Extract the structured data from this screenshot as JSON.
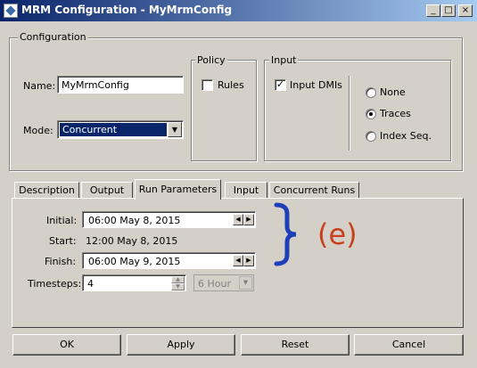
{
  "window": {
    "title": "MRM Configuration - MyMrmConfig",
    "controls": {
      "minimize": "_",
      "maximize": "□",
      "close": "×"
    }
  },
  "configuration": {
    "legend": "Configuration",
    "name_label": "Name:",
    "name_value": "MyMrmConfig",
    "mode_label": "Mode:",
    "mode_value": "Concurrent"
  },
  "policy": {
    "legend": "Policy",
    "rules_label": "Rules",
    "rules_checked": false
  },
  "input": {
    "legend": "Input",
    "input_dmis_label": "Input DMIs",
    "input_dmis_checked": true,
    "radios": [
      {
        "label": "None",
        "selected": false
      },
      {
        "label": "Traces",
        "selected": true
      },
      {
        "label": "Index Seq.",
        "selected": false
      }
    ]
  },
  "tabs": [
    {
      "label": "Description"
    },
    {
      "label": "Output"
    },
    {
      "label": "Run Parameters",
      "active": true
    },
    {
      "label": "Input"
    },
    {
      "label": "Concurrent Runs"
    }
  ],
  "run_parameters": {
    "initial_label": "Initial:",
    "initial_value": "06:00 May 8, 2015",
    "start_label": "Start:",
    "start_value": "12:00 May 8, 2015",
    "finish_label": "Finish:",
    "finish_value": "06:00 May 9, 2015",
    "timesteps_label": "Timesteps:",
    "timesteps_value": "4",
    "interval_value": "6 Hour"
  },
  "annotation": {
    "brace": "}",
    "label": "(e)",
    "brace_color": "#1f3fb8",
    "label_color": "#c8401e"
  },
  "buttons": {
    "ok": "OK",
    "apply": "Apply",
    "reset": "Reset",
    "cancel": "Cancel"
  },
  "colors": {
    "titlebar_start": "#0a246a",
    "titlebar_end": "#a6caf0",
    "face": "#d4d0c8",
    "selection": "#0a246a"
  }
}
